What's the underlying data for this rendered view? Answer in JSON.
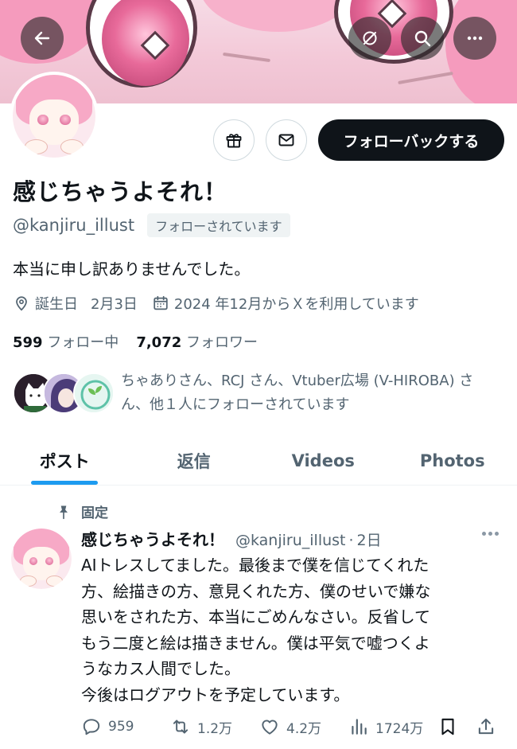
{
  "header": {
    "back_icon": "arrow-left-icon",
    "translate_icon": "circle-slash-icon",
    "search_icon": "search-icon",
    "more_icon": "more-horizontal-icon"
  },
  "profile": {
    "display_name": "感じちゃうよそれ！",
    "handle": "@kanjiru_illust",
    "follows_you": "フォローされています",
    "bio": "本当に申し訳ありませんでした。",
    "birthday_label": "誕生日",
    "birthday_value": "2月3日",
    "joined": "2024 年12月からＸを利用しています",
    "following_count": "599",
    "following_label": "フォロー中",
    "followers_count": "7,072",
    "followers_label": "フォロワー",
    "followed_by_text": "ちゃありさん、RCJ さん、Vtuber広場 (V-HIROBA) さん、他１人にフォローされています"
  },
  "actions": {
    "follow_back": "フォローバックする"
  },
  "tabs": [
    {
      "label": "ポスト"
    },
    {
      "label": "返信"
    },
    {
      "label": "Videos"
    },
    {
      "label": "Photos"
    }
  ],
  "post": {
    "pinned_label": "固定",
    "name": "感じちゃうよそれ！",
    "handle": "@kanjiru_illust",
    "separator": "·",
    "time": "2日",
    "lines": [
      "AIトレスしてました。最後まで僕を信じてくれた",
      "方、絵描きの方、意見くれた方、僕のせいで嫌な",
      "思いをされた方、本当にごめんなさい。反省して",
      "もう二度と絵は描きません。僕は平気で嘘つくよ",
      "うなカス人間でした。",
      "今後はログアウトを予定しています。"
    ],
    "replies": "959",
    "reposts": "1.2万",
    "likes": "4.2万",
    "views": "1724万"
  },
  "colors": {
    "accent": "#1d9bf0",
    "text": "#0f1419",
    "muted": "#536471",
    "follow_button": "#0f1419"
  }
}
